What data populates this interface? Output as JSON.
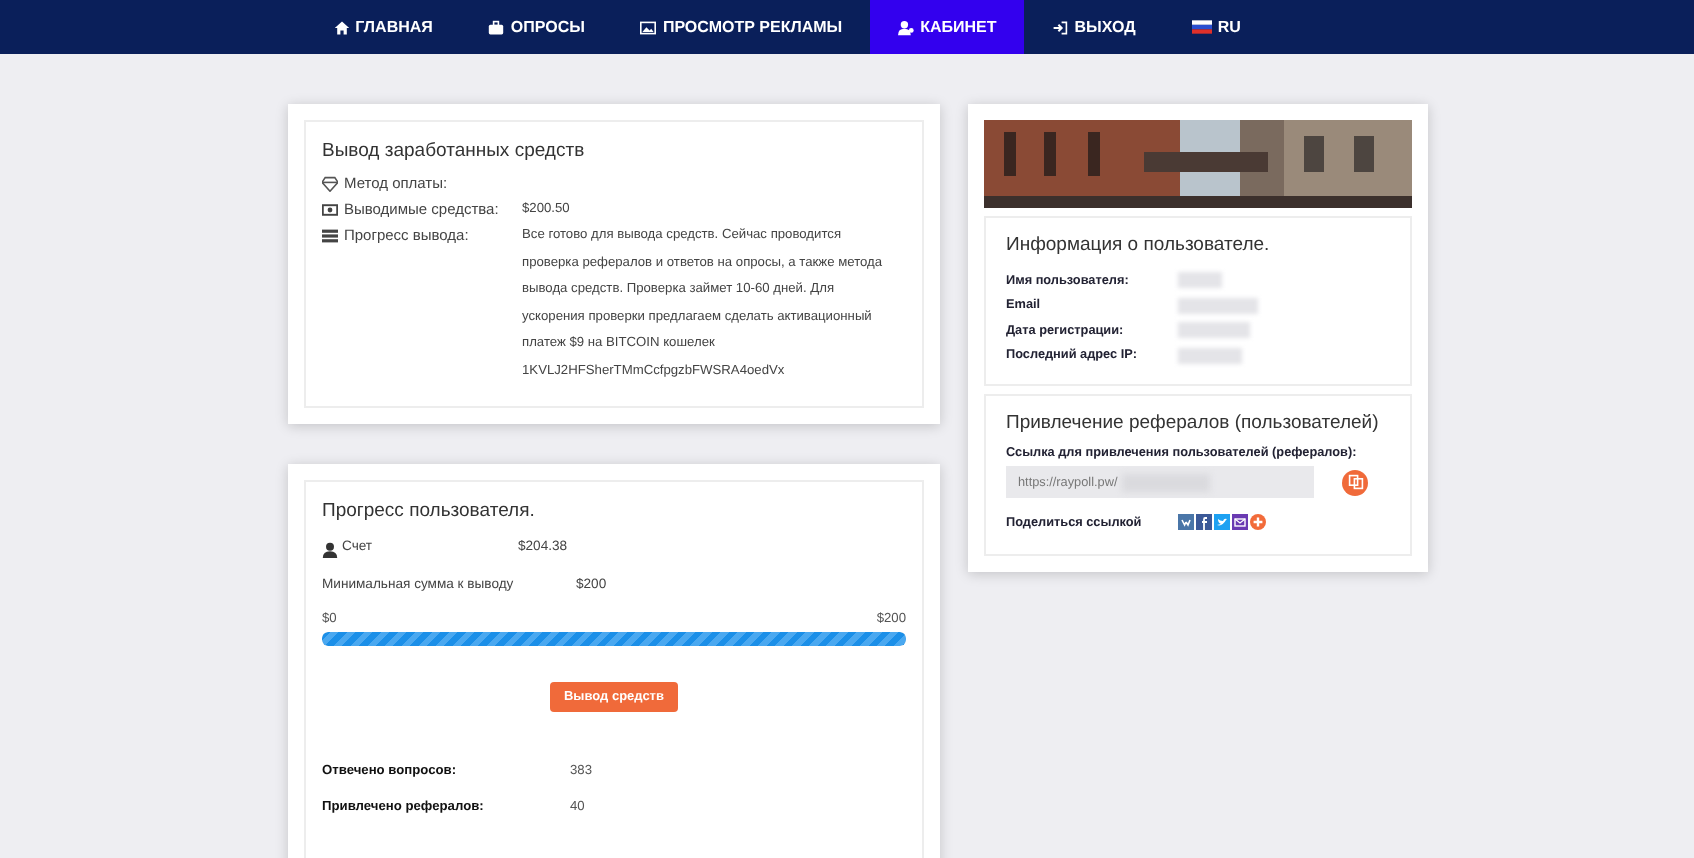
{
  "nav": [
    {
      "label": "ГЛАВНАЯ",
      "selected": false
    },
    {
      "label": "ОПРОСЫ",
      "selected": false
    },
    {
      "label": "ПРОСМОТР РЕКЛАМЫ",
      "selected": false
    },
    {
      "label": "КАБИНЕТ",
      "selected": true
    },
    {
      "label": "ВЫХОД",
      "selected": false
    },
    {
      "label": "RU",
      "selected": false
    }
  ],
  "withdrawal": {
    "title": "Вывод заработанных средств",
    "rows": [
      {
        "label": "Метод оплаты:",
        "value": ""
      },
      {
        "label": "Выводимые средства:",
        "value": "$200.50"
      },
      {
        "label": "Прогресс вывода:",
        "value": "Все готово для вывода средств. Сейчас проводится проверка рефералов и ответов на опросы, а также метода вывода средств. Проверка займет 10-60 дней. Для ускорения проверки предлагаем сделать активационный платеж $9 на BITCOIN кошелек 1KVLJ2HFSherTMmCcfpgzbFWSRA4oedVx"
      }
    ]
  },
  "progress": {
    "title": "Прогресс пользователя.",
    "account_label": "Счет",
    "account_value": "$204.38",
    "min_label": "Минимальная сумма к выводу",
    "min_value": "$200",
    "scale_min": "$0",
    "scale_max": "$200",
    "level": 1,
    "button": "Вывод средств",
    "stats": [
      {
        "label": "Отвечено вопросов:",
        "value": "383"
      },
      {
        "label": "Привлечено рефералов:",
        "value": "40"
      }
    ]
  },
  "user_info": {
    "title": "Информация о пользователе.",
    "fields": [
      {
        "label": "Имя пользователя:"
      },
      {
        "label": "Email"
      },
      {
        "label": "Дата регистрации:"
      },
      {
        "label": "Последний адрес IP:"
      }
    ]
  },
  "referrals": {
    "title": "Привлечение рефералов (пользователей)",
    "link_label": "Ссылка для привлечения пользователей (рефералов):",
    "link_value": "https://raypoll.pw/",
    "share_label": "Поделиться ссылкой"
  }
}
